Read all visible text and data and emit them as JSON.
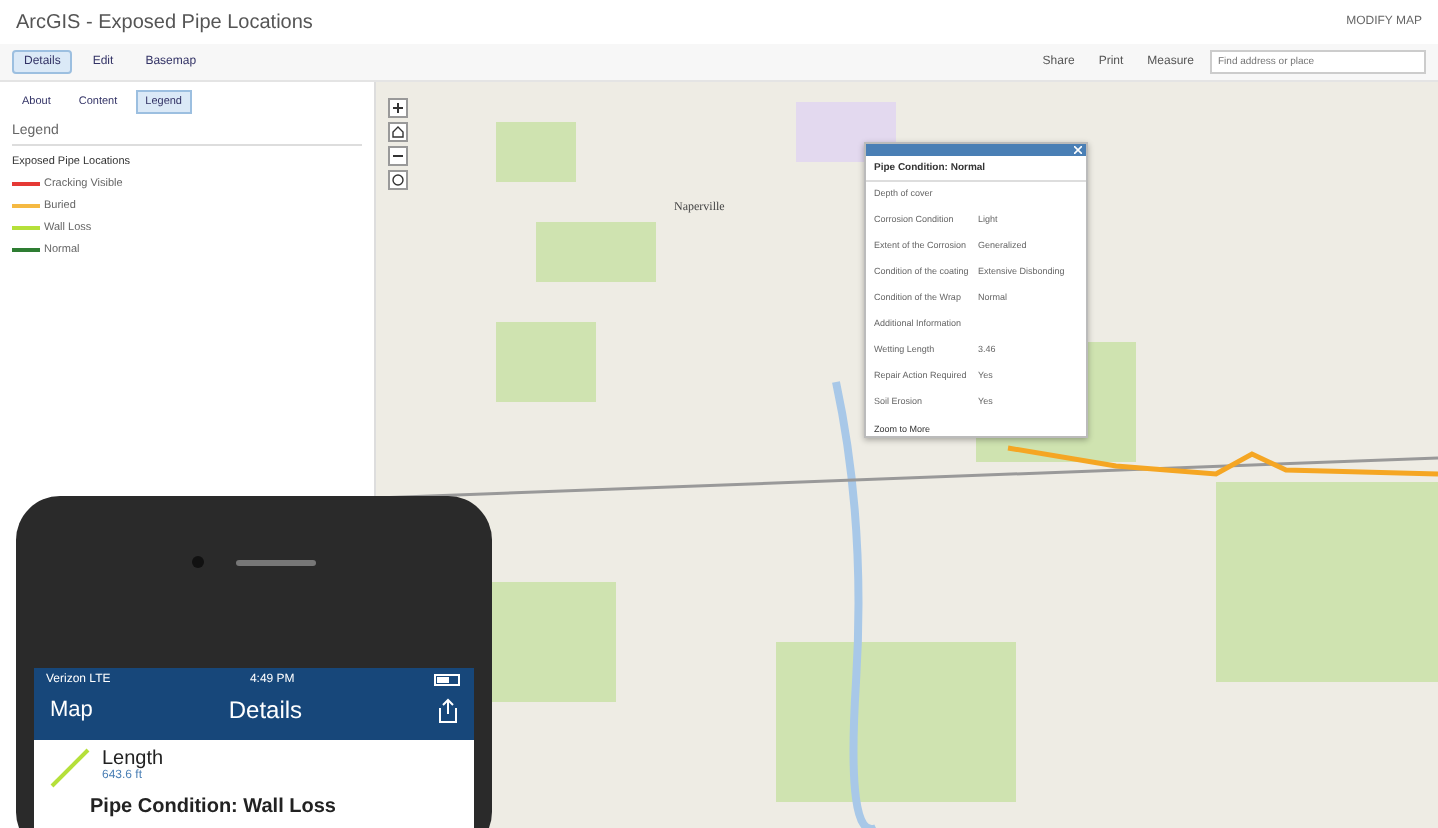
{
  "app": {
    "title": "ArcGIS - Exposed Pipe Locations",
    "account": "MODIFY MAP"
  },
  "toolbar": {
    "left": [
      {
        "label": "Details",
        "selected": true
      },
      {
        "label": "Edit",
        "selected": false
      },
      {
        "label": "Basemap",
        "selected": false
      }
    ],
    "right": [
      "Share",
      "Print",
      "Measure"
    ],
    "search": {
      "placeholder": "Find address or place"
    }
  },
  "tabs": [
    {
      "label": "About",
      "selected": false
    },
    {
      "label": "Content",
      "selected": false
    },
    {
      "label": "Legend",
      "selected": true
    }
  ],
  "legend": {
    "heading": "Legend",
    "layer": "Exposed Pipe Locations",
    "items": [
      {
        "label": "Cracking Visible",
        "color": "#e53935"
      },
      {
        "label": "Buried",
        "color": "#f5b942"
      },
      {
        "label": "Wall Loss",
        "color": "#b5e03a"
      },
      {
        "label": "Normal",
        "color": "#2e7d32"
      }
    ]
  },
  "map": {
    "place": "Naperville"
  },
  "popup": {
    "title": "Pipe Condition: Normal",
    "fields": [
      {
        "label": "Depth of cover"
      },
      {
        "label": "Corrosion Condition",
        "value": "Light"
      },
      {
        "label": "Extent of the Corrosion",
        "value": "Generalized"
      },
      {
        "label": "Condition of the coating",
        "value": "Extensive Disbonding"
      },
      {
        "label": "Condition of the Wrap",
        "value": "Normal"
      },
      {
        "label": "Additional Information"
      },
      {
        "label": "Wetting Length",
        "value": "3.46"
      },
      {
        "label": "Repair Action Required",
        "value": "Yes"
      },
      {
        "label": "Soil Erosion",
        "value": "Yes"
      }
    ],
    "footer": "Zoom to  More"
  },
  "phone": {
    "carrier": "Verizon LTE",
    "time": "4:49 PM",
    "back": "Map",
    "title": "Details",
    "field": "Length",
    "value": "643.6 ft",
    "heading": "Pipe Condition: Wall Loss"
  }
}
